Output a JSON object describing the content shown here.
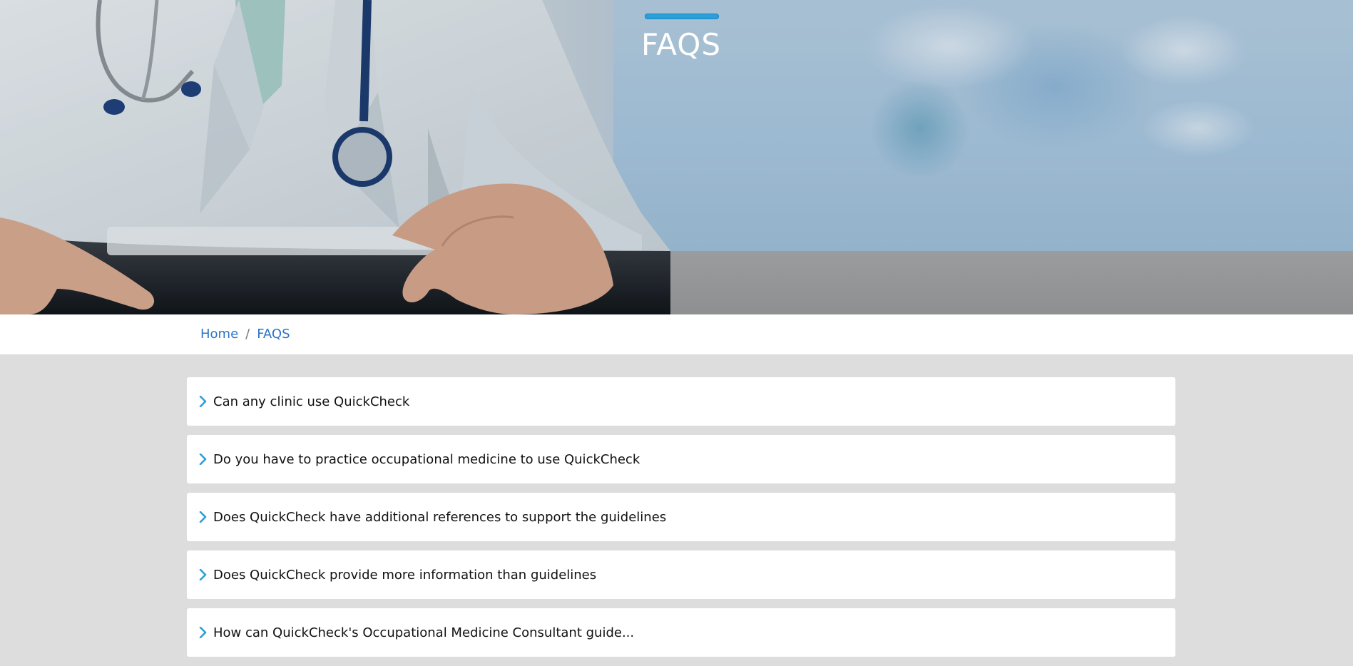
{
  "hero": {
    "title": "FAQS",
    "accent_color": "#2a9fd8"
  },
  "breadcrumb": {
    "home": "Home",
    "separator": "/",
    "current": "FAQS",
    "link_color": "#2b74c8"
  },
  "faq": {
    "icon": "chevron-right-icon",
    "items": [
      {
        "question": "Can any clinic use QuickCheck"
      },
      {
        "question": "Do you have to practice occupational medicine to use QuickCheck"
      },
      {
        "question": "Does QuickCheck have additional references to support the guidelines"
      },
      {
        "question": "Does QuickCheck provide more information than guidelines"
      },
      {
        "question": "How can QuickCheck's Occupational Medicine Consultant guide..."
      }
    ]
  }
}
